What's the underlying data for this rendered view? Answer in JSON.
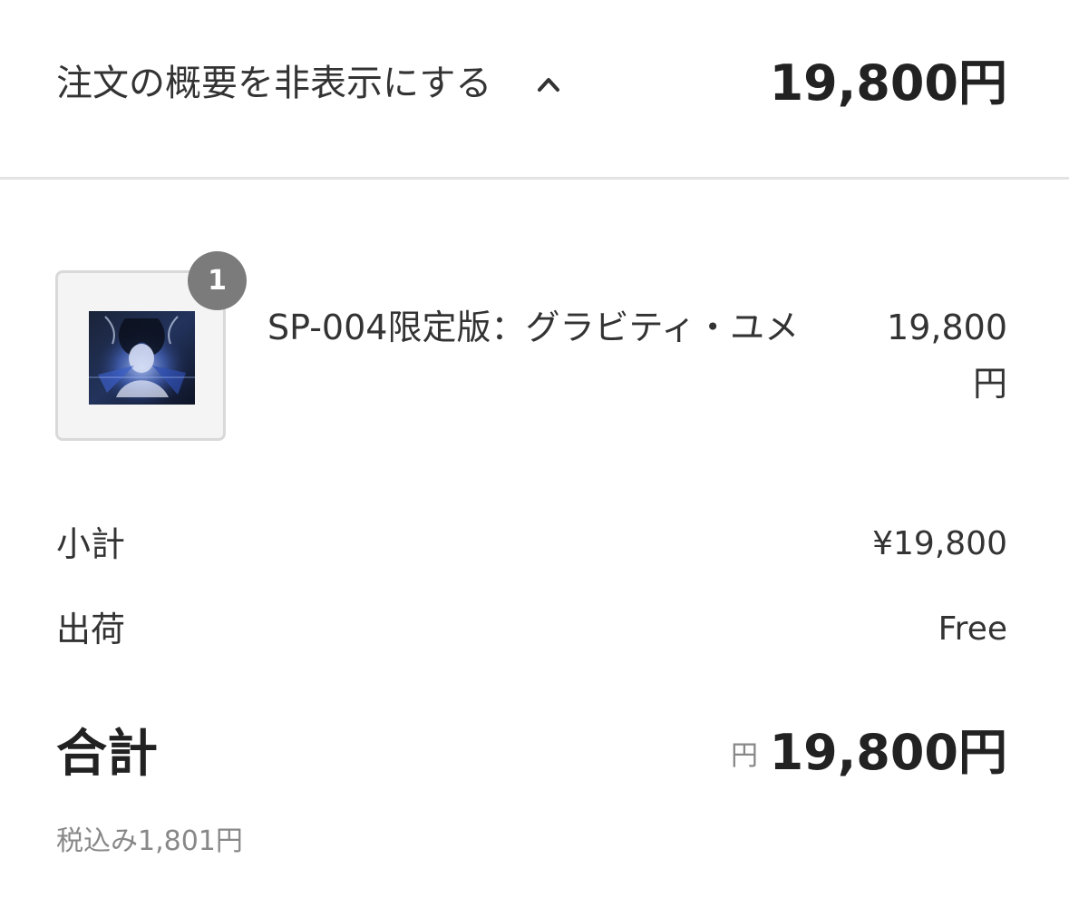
{
  "summary_toggle": {
    "label": "注文の概要を非表示にする",
    "icon": "chevron-up-icon",
    "total": "19,800円"
  },
  "line_item": {
    "quantity": "1",
    "name": "SP-004限定版：グラビティ・ユメ",
    "price": "19,800円",
    "thumbnail": "product-artwork"
  },
  "subtotal": {
    "label": "小計",
    "value": "¥19,800"
  },
  "shipping": {
    "label": "出荷",
    "value": "Free"
  },
  "total": {
    "label": "合計",
    "currency": "円",
    "value": "19,800円"
  },
  "tax_note": "税込み1,801円"
}
